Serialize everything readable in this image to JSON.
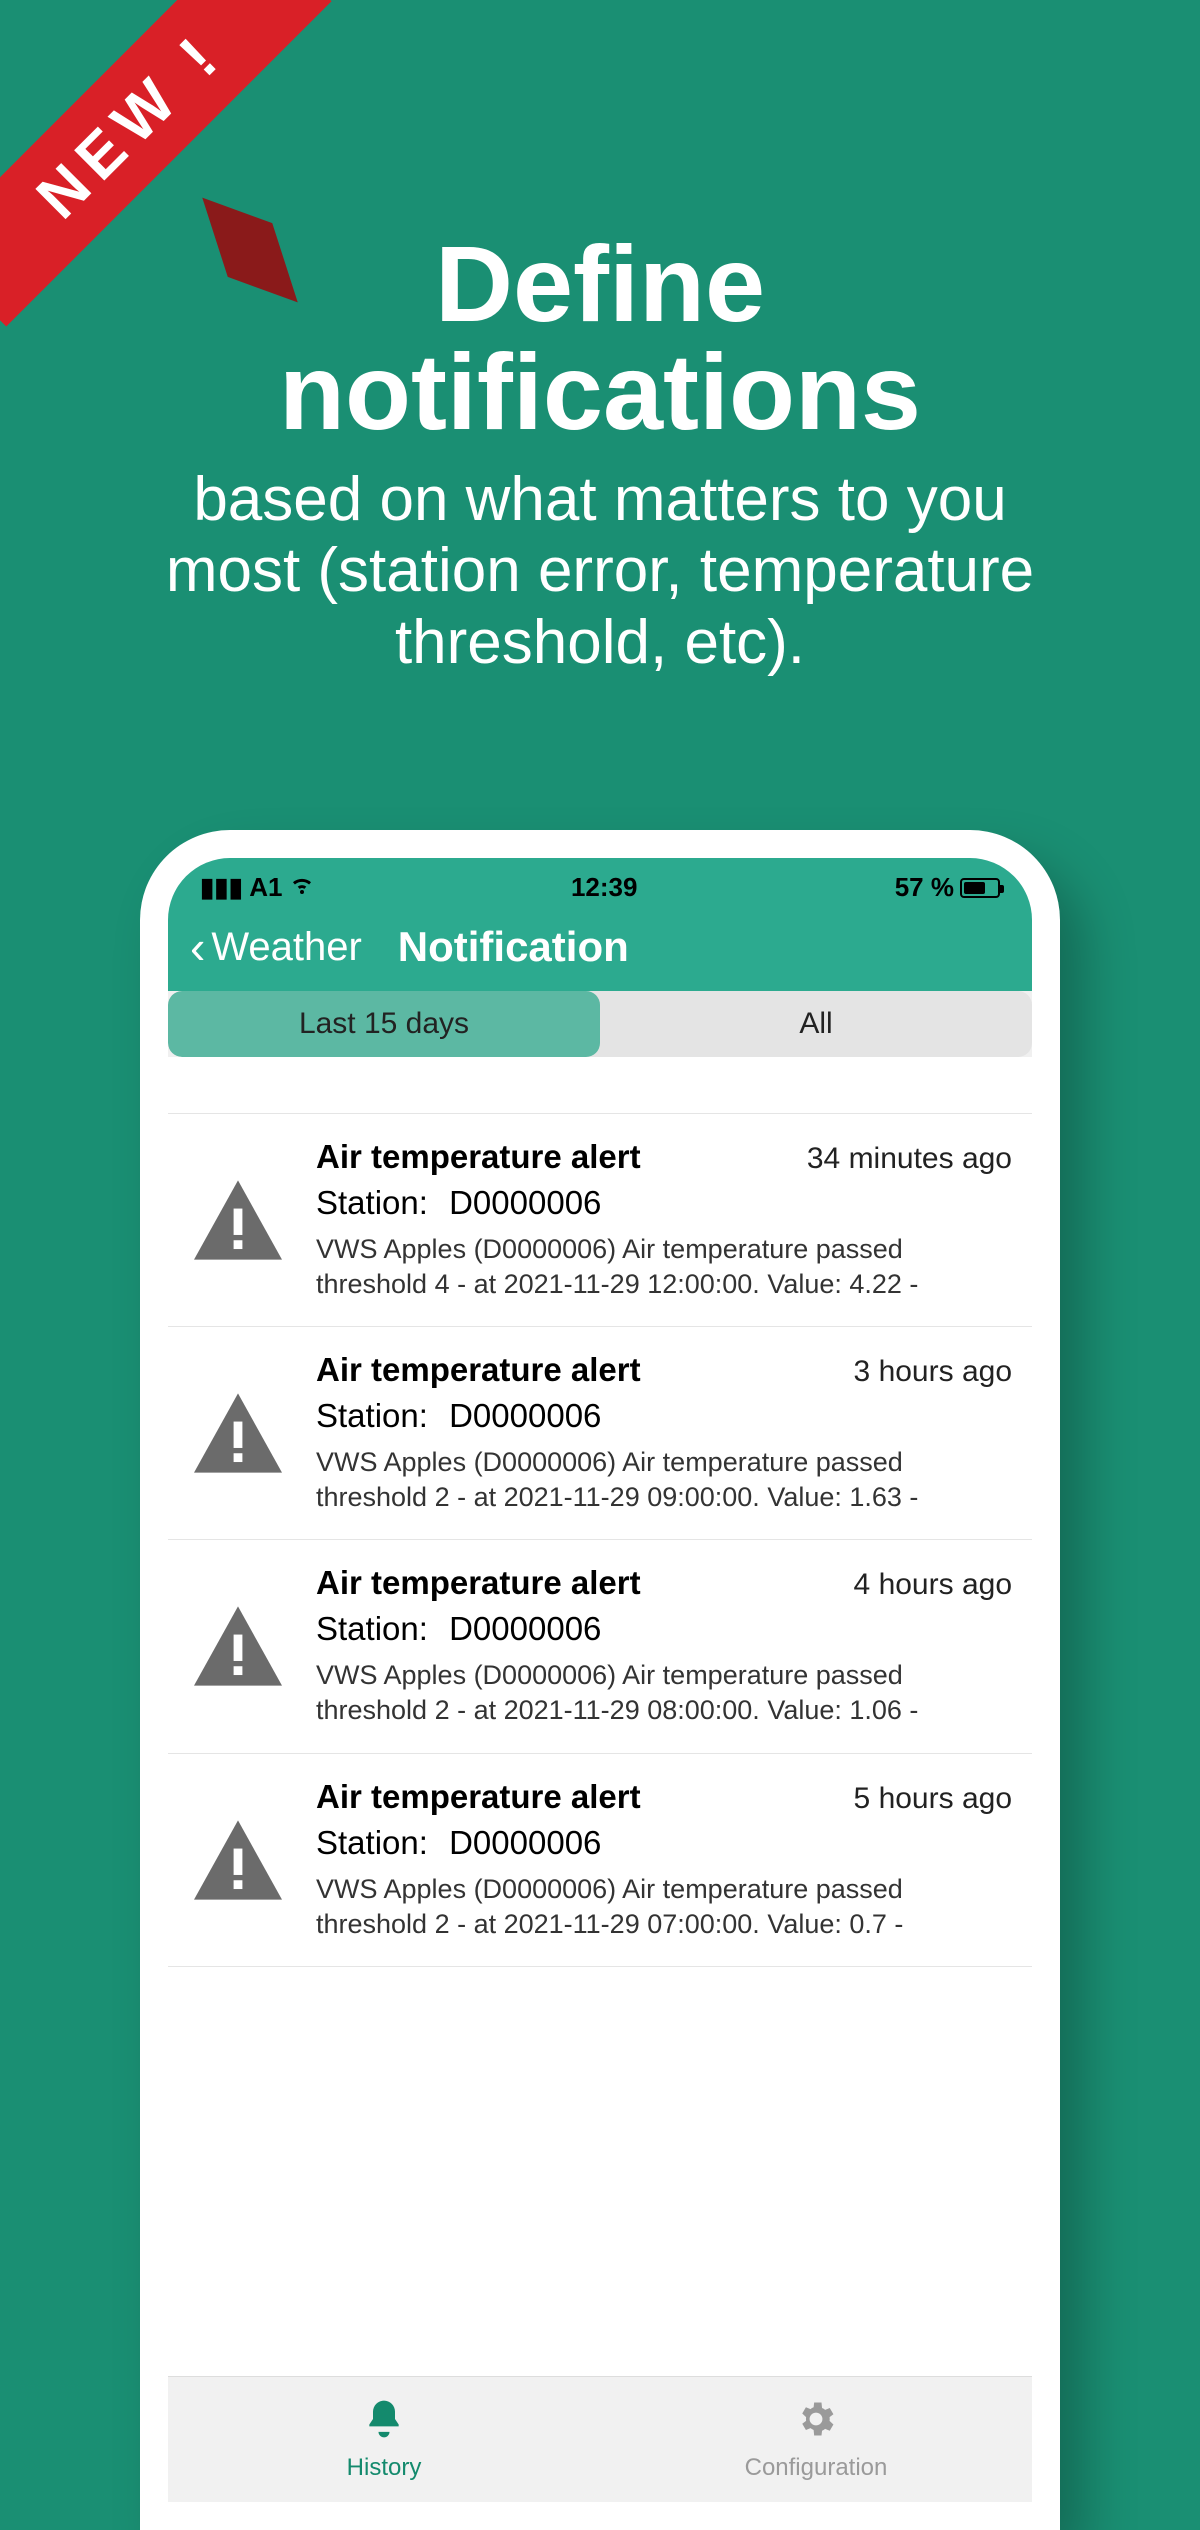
{
  "ribbon": {
    "text": "NEW !"
  },
  "headline": {
    "big": "Define notifications",
    "sub": "based on what matters to you most (station error, temperature threshold, etc)."
  },
  "statusbar": {
    "carrier": "A1",
    "time": "12:39",
    "battery_pct": "57 %"
  },
  "navbar": {
    "back_label": "Weather",
    "title": "Notification"
  },
  "segmented": {
    "active": "Last  15 days",
    "other": "All"
  },
  "station_label": "Station:",
  "notifications": [
    {
      "title": "Air temperature alert",
      "time_ago": "34 minutes ago",
      "station": "D0000006",
      "desc": "VWS Apples (D0000006) Air temperature passed threshold 4 - at 2021-11-29 12:00:00. Value: 4.22 -"
    },
    {
      "title": "Air temperature alert",
      "time_ago": "3 hours ago",
      "station": "D0000006",
      "desc": "VWS Apples (D0000006) Air temperature passed threshold 2 - at 2021-11-29 09:00:00. Value: 1.63 -"
    },
    {
      "title": "Air temperature alert",
      "time_ago": "4 hours ago",
      "station": "D0000006",
      "desc": "VWS Apples (D0000006) Air temperature passed threshold 2 - at 2021-11-29 08:00:00. Value: 1.06 -"
    },
    {
      "title": "Air temperature alert",
      "time_ago": "5 hours ago",
      "station": "D0000006",
      "desc": "VWS Apples (D0000006) Air temperature passed threshold 2 - at 2021-11-29 07:00:00. Value: 0.7 -"
    }
  ],
  "tabs": {
    "history": "History",
    "config": "Configuration"
  }
}
